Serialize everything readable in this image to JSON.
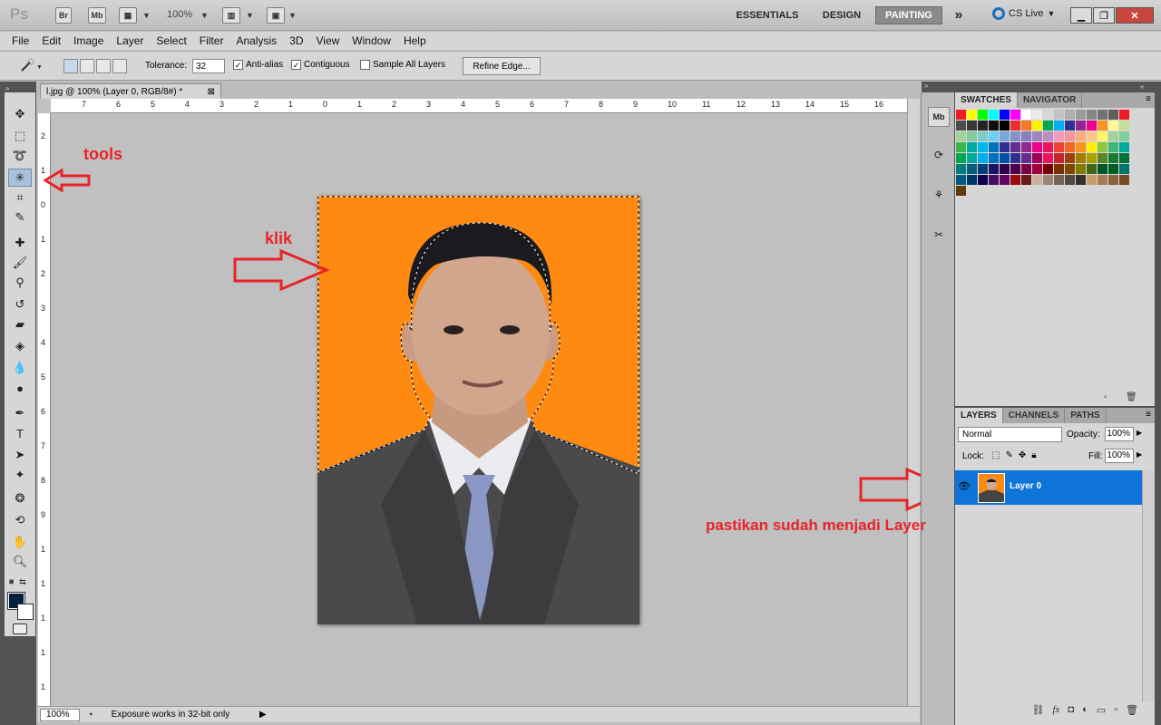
{
  "appbar": {
    "logo": "Ps",
    "bridge": "Br",
    "minibridge": "Mb",
    "zoom": "100%",
    "workspaces": [
      "ESSENTIALS",
      "DESIGN",
      "PAINTING"
    ],
    "overflow": "»",
    "cslive": "CS Live"
  },
  "menu": [
    "File",
    "Edit",
    "Image",
    "Layer",
    "Select",
    "Filter",
    "Analysis",
    "3D",
    "View",
    "Window",
    "Help"
  ],
  "options": {
    "tolerance_label": "Tolerance:",
    "tolerance_value": "32",
    "anti_alias": "Anti-alias",
    "contiguous": "Contiguous",
    "sample_all": "Sample All Layers",
    "refine": "Refine Edge..."
  },
  "document": {
    "tab_title": "l.jpg @ 100% (Layer 0, RGB/8#) *",
    "tab_close": "⊠",
    "ruler_top": [
      "7",
      "6",
      "5",
      "4",
      "3",
      "2",
      "1",
      "0",
      "1",
      "2",
      "3",
      "4",
      "5",
      "6",
      "7",
      "8",
      "9",
      "10",
      "11",
      "12",
      "13",
      "14",
      "15",
      "16"
    ],
    "ruler_left": [
      "2",
      "1",
      "0",
      "1",
      "2",
      "3",
      "4",
      "5",
      "6",
      "7",
      "8",
      "9",
      "1",
      "1",
      "1",
      "1",
      "1"
    ]
  },
  "status": {
    "zoom": "100%",
    "text": "Exposure works in 32-bit only"
  },
  "annotations": {
    "tools": "tools",
    "klik": "klik",
    "layer_note": "pastikan sudah menjadi Layer"
  },
  "panels": {
    "swatch_tabs": [
      "SWATCHES",
      "NAVIGATOR"
    ],
    "layer_tabs": [
      "LAYERS",
      "CHANNELS",
      "PATHS"
    ],
    "blend_mode": "Normal",
    "opacity_label": "Opacity:",
    "opacity": "100%",
    "lock_label": "Lock:",
    "fill_label": "Fill:",
    "fill": "100%",
    "layer_name": "Layer 0"
  },
  "swatch_colors": [
    "#ed1c24",
    "#ffff00",
    "#00ff00",
    "#00ffff",
    "#0000ff",
    "#ff00ff",
    "#ffffff",
    "#ebebeb",
    "#d7d7d7",
    "#c3c3c3",
    "#afafaf",
    "#9b9b9b",
    "#878787",
    "#737373",
    "#5f5f5f",
    "#ed1c24",
    "#4b4b4b",
    "#373737",
    "#232323",
    "#0f0f0f",
    "#000000",
    "#ee2e2e",
    "#f47920",
    "#fff200",
    "#00a651",
    "#00aeef",
    "#2e3192",
    "#92278f",
    "#ec008c",
    "#f7941d",
    "#fff799",
    "#c4df9b",
    "#a3d39c",
    "#82ca9c",
    "#7accc8",
    "#6dcff6",
    "#7da7d9",
    "#8393ca",
    "#8781bd",
    "#a186be",
    "#bd8cbf",
    "#f49ac1",
    "#f5989d",
    "#f9ad81",
    "#fdc689",
    "#fff568",
    "#a2d39c",
    "#7ecf9b",
    "#39b54a",
    "#00a99d",
    "#00b7eb",
    "#0072bc",
    "#2e3192",
    "#662d91",
    "#92278f",
    "#ec008c",
    "#ed145b",
    "#ef4136",
    "#f26522",
    "#f7941d",
    "#fff200",
    "#8dc63f",
    "#3cb878",
    "#00a99d",
    "#00a650",
    "#00a99d",
    "#00aeef",
    "#0072bc",
    "#0054a6",
    "#2e3192",
    "#662d91",
    "#9e005d",
    "#ed145b",
    "#c1272d",
    "#a0410d",
    "#a67c00",
    "#aba000",
    "#598527",
    "#197b30",
    "#007236",
    "#007c7a",
    "#005e7a",
    "#003e7a",
    "#1b1464",
    "#32004b",
    "#4b0049",
    "#7b0046",
    "#9e0039",
    "#790000",
    "#7b2e00",
    "#7d4900",
    "#827b00",
    "#406618",
    "#005826",
    "#005e20",
    "#00746b",
    "#005b7f",
    "#003663",
    "#0d004c",
    "#440e62",
    "#630460",
    "#9e0b0f",
    "#6f1a1a",
    "#c7b299",
    "#998675",
    "#736357",
    "#534741",
    "#37302a",
    "#c69c6d",
    "#a67c52",
    "#8c6239",
    "#754c24",
    "#603913"
  ],
  "colors": {
    "canvas_bg": "#ff8a12",
    "accent_blue": "#0f74d9",
    "annotation_red": "#e8232a",
    "foreground": "#05203c"
  },
  "icons": {
    "eye": "eye-icon",
    "wand": "magic-wand-icon"
  }
}
